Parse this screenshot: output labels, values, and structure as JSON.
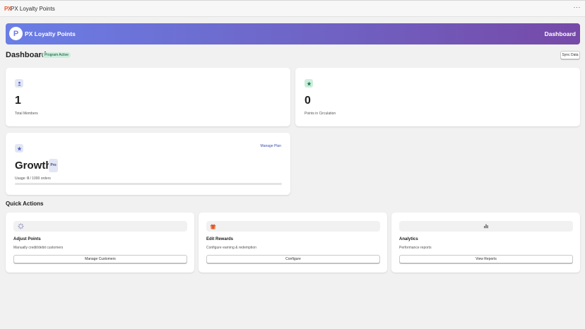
{
  "app": {
    "logo_text": "PX",
    "title": "PX Loyalty Points",
    "more_label": "···"
  },
  "banner": {
    "logo_letter": "P",
    "title": "PX Loyalty Points",
    "right_label": "Dashboard"
  },
  "header": {
    "title": "Dashboard",
    "status_badge": "Program Active",
    "sync_button": "Sync Data"
  },
  "stats": [
    {
      "value": "1",
      "label": "Total Members",
      "icon": "person-icon",
      "icon_bg": "#e3e6f3"
    },
    {
      "value": "0",
      "label": "Points in Circulation",
      "icon": "star-icon",
      "icon_bg": "#cdeedd"
    }
  ],
  "plan": {
    "icon": "star-icon",
    "name": "Growth",
    "badge": "Pro",
    "manage_link": "Manage Plan",
    "usage_prefix": "Usage: ",
    "usage_used": "0",
    "usage_suffix": " / 1000 orders",
    "usage_fraction": 0.0
  },
  "quick_actions": {
    "title": "Quick Actions",
    "items": [
      {
        "icon": "sparkle-icon",
        "title": "Adjust Points",
        "description": "Manually credit/debit customers",
        "button": "Manage Customers"
      },
      {
        "icon": "gift-icon",
        "title": "Edit Rewards",
        "description": "Configure earning & redemption",
        "button": "Configure"
      },
      {
        "icon": "bar-chart-icon",
        "title": "Analytics",
        "description": "Performance reports",
        "button": "View Reports"
      }
    ]
  },
  "colors": {
    "brand_gradient_start": "#6a7ee6",
    "brand_gradient_end": "#7649a8",
    "link": "#3a4fb0",
    "success_bg": "#cdeedd"
  }
}
